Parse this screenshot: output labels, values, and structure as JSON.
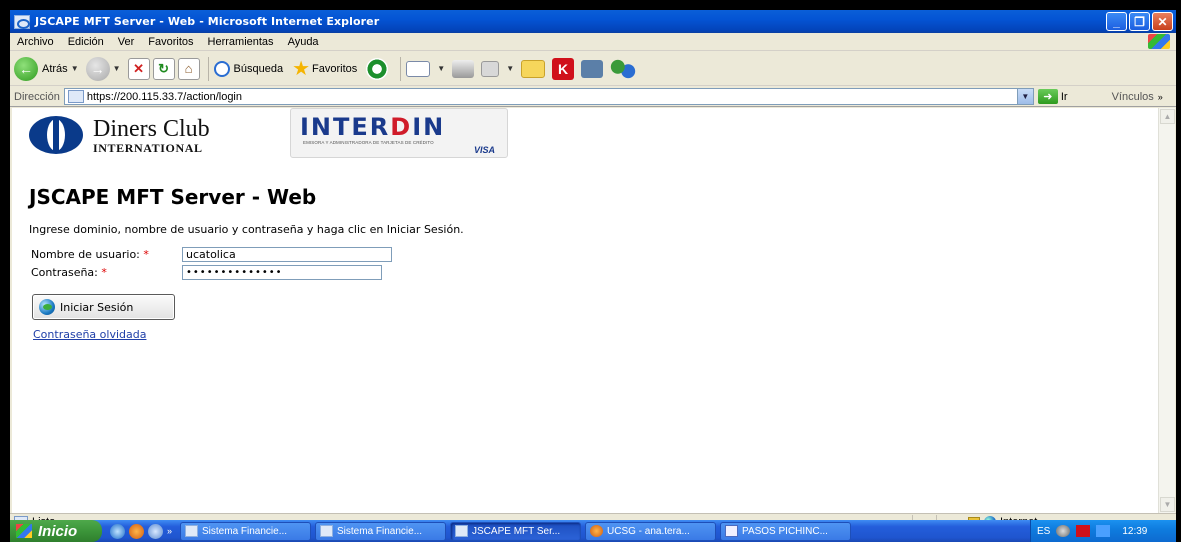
{
  "window": {
    "title": "JSCAPE MFT Server - Web - Microsoft Internet Explorer",
    "buttons": {
      "minimize": "_",
      "maximize": "❐",
      "close": "✕"
    }
  },
  "menu": {
    "items": [
      "Archivo",
      "Edición",
      "Ver",
      "Favoritos",
      "Herramientas",
      "Ayuda"
    ]
  },
  "toolbar": {
    "back_label": "Atrás",
    "search_label": "Búsqueda",
    "favorites_label": "Favoritos",
    "icons": [
      "back-icon",
      "forward-icon",
      "stop-icon",
      "refresh-icon",
      "home-icon",
      "search-icon",
      "favorites-icon",
      "history-icon",
      "mail-icon",
      "print-icon",
      "edit-icon",
      "folder-icon",
      "k-icon",
      "camera-icon",
      "messenger-icon"
    ]
  },
  "address": {
    "label": "Dirección",
    "url": "https://200.115.33.7/action/login",
    "go_label": "Ir",
    "links_label": "Vínculos"
  },
  "page": {
    "diners_line1": "Diners Club",
    "diners_line2": "INTERNATIONAL",
    "interdin_brand": "INTERDIN",
    "interdin_sub": "EMISORA Y ADMINISTRADORA DE TARJETAS DE CRÉDITO",
    "interdin_visa": "VISA",
    "title": "JSCAPE MFT Server - Web",
    "instructions": "Ingrese dominio, nombre de usuario y contraseña y haga clic en Iniciar Sesión.",
    "username_label": "Nombre de usuario:",
    "username_value": "ucatolica",
    "password_label": "Contraseña:",
    "password_value": "••••••••••••••",
    "required_mark": "*",
    "login_button": "Iniciar Sesión",
    "forgot_link": "Contraseña olvidada"
  },
  "status": {
    "text": "Listo",
    "zone": "Internet"
  },
  "taskbar": {
    "start_label": "Inicio",
    "quicklaunch_more": "»",
    "tasks": [
      {
        "label": "Sistema Financie...",
        "icon": "ie-icon",
        "active": false
      },
      {
        "label": "Sistema Financie...",
        "icon": "ie-icon",
        "active": false
      },
      {
        "label": "JSCAPE MFT Ser...",
        "icon": "ie-icon",
        "active": true
      },
      {
        "label": "UCSG - ana.tera...",
        "icon": "firefox-icon",
        "active": false
      },
      {
        "label": "PASOS PICHINC...",
        "icon": "word-icon",
        "active": false
      }
    ],
    "language": "ES",
    "clock": "12:39"
  }
}
